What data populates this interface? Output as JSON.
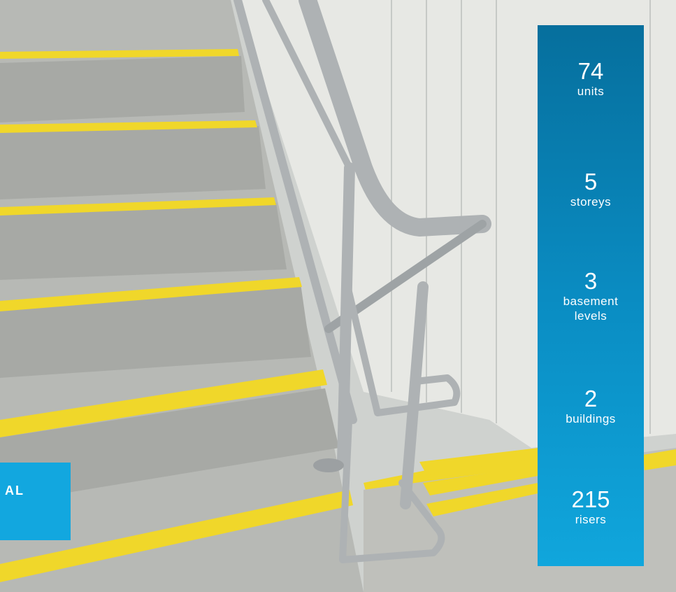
{
  "tag": {
    "label": "AL"
  },
  "stats": [
    {
      "value": "74",
      "label": "units"
    },
    {
      "value": "5",
      "label": "storeys"
    },
    {
      "value": "3",
      "label": "basement levels"
    },
    {
      "value": "2",
      "label": "buildings"
    },
    {
      "value": "215",
      "label": "risers"
    }
  ],
  "colors": {
    "panel_top": "#066f9d",
    "panel_bottom": "#10a6dc",
    "tag": "#12a7df",
    "stair_nosing": "#f1d82a",
    "concrete": "#b9bbb7"
  }
}
